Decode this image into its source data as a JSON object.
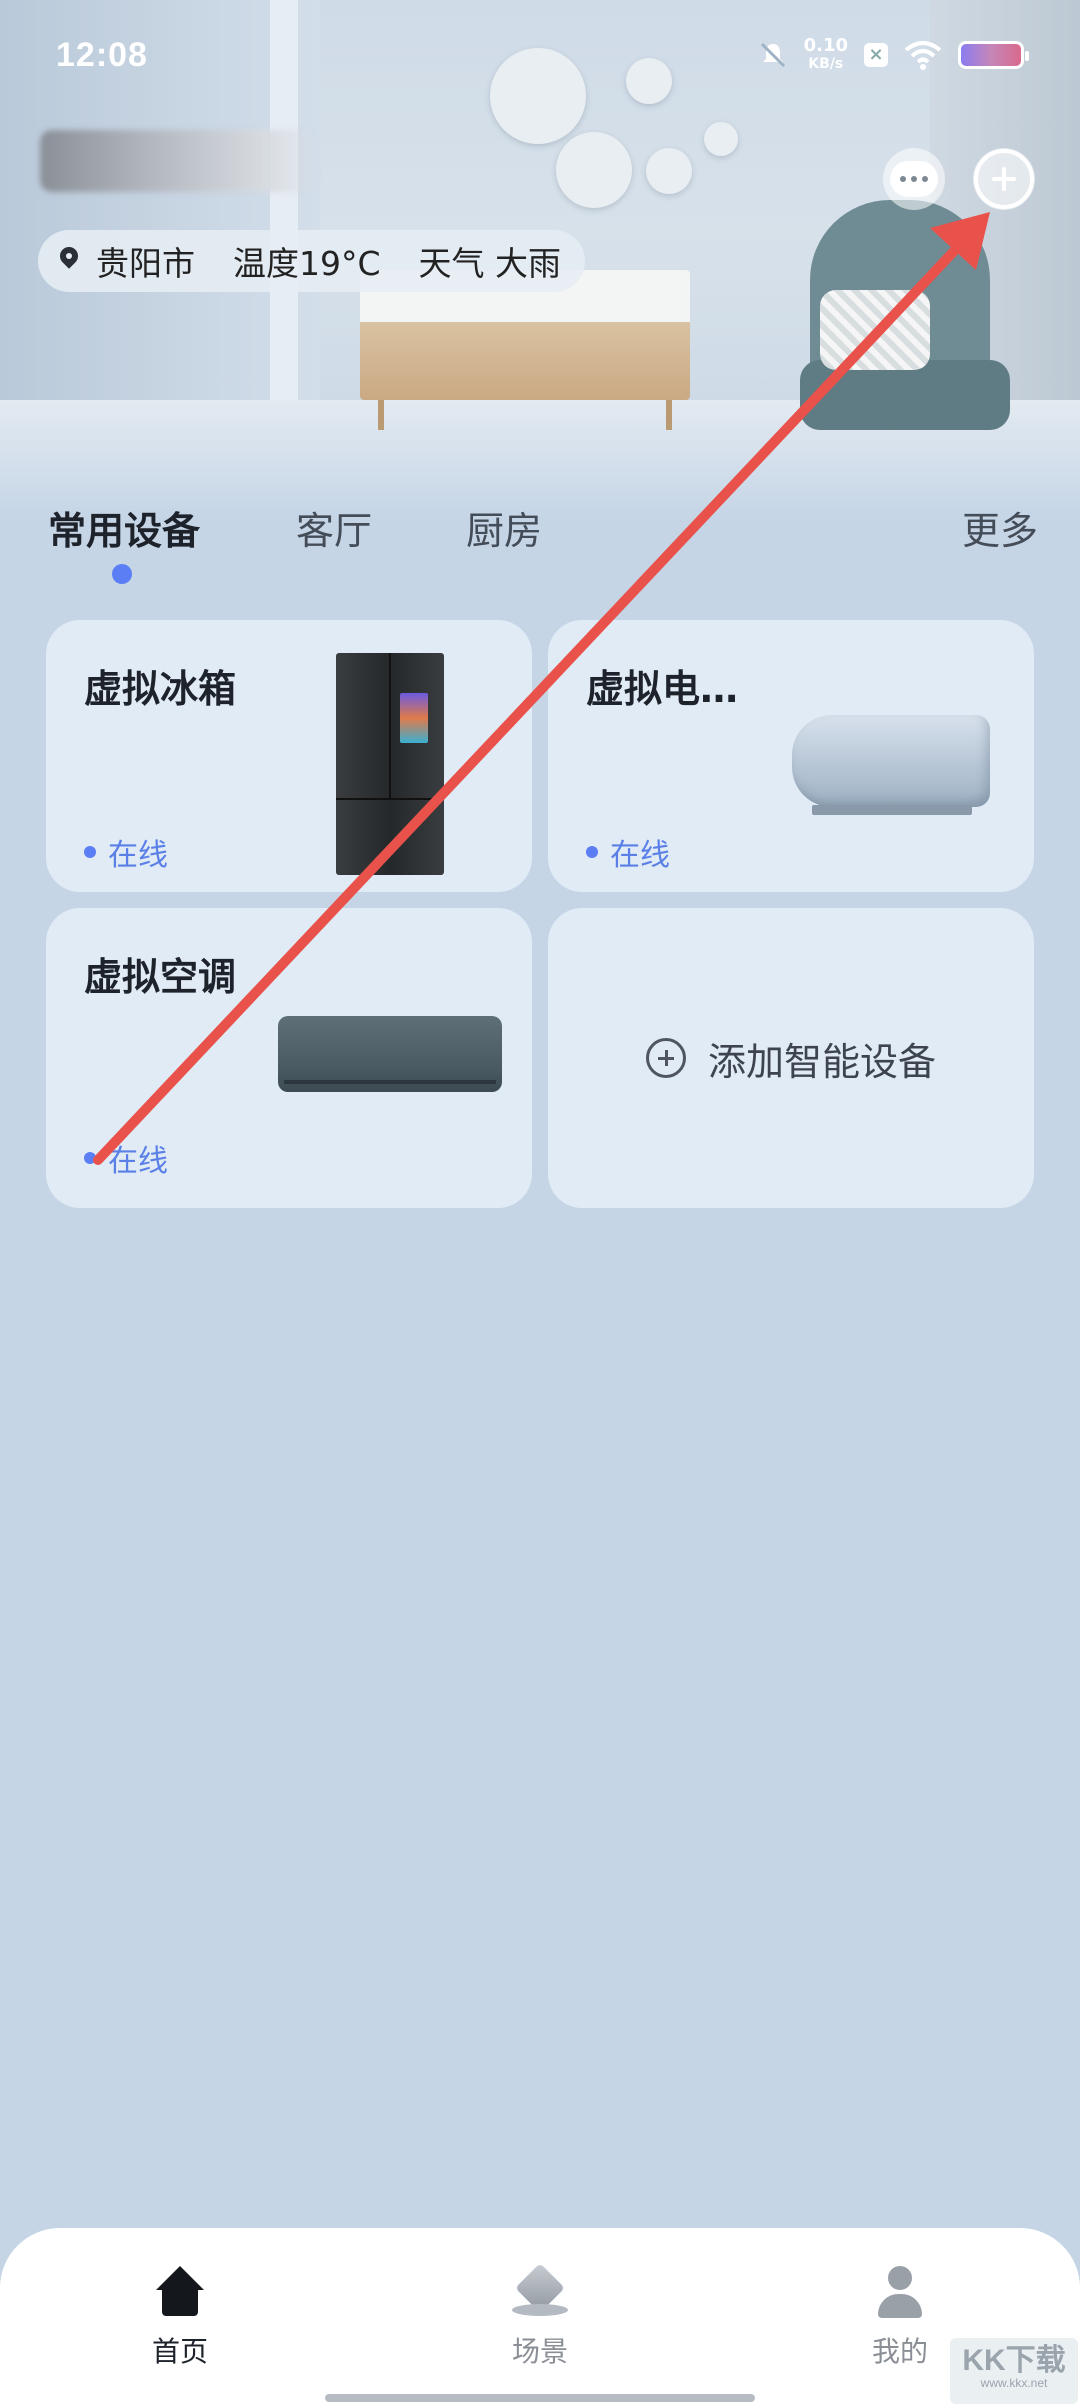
{
  "status_bar": {
    "time": "12:08",
    "net_speed_value": "0.10",
    "net_speed_unit": "KB/s"
  },
  "location": {
    "city": "贵阳市",
    "temperature": "温度19°C",
    "weather": "天气 大雨"
  },
  "tabs": [
    {
      "label": "常用设备",
      "active": true
    },
    {
      "label": "客厅"
    },
    {
      "label": "厨房"
    }
  ],
  "more_label": "更多",
  "devices": [
    {
      "name": "虚拟冰箱",
      "status": "在线"
    },
    {
      "name": "虚拟电…",
      "status": "在线"
    },
    {
      "name": "虚拟空调",
      "status": "在线"
    }
  ],
  "add_device_label": "添加智能设备",
  "bottom_nav": [
    {
      "label": "首页",
      "active": true
    },
    {
      "label": "场景"
    },
    {
      "label": "我的"
    }
  ],
  "watermark": {
    "text": "KK下载",
    "url": "www.kkx.net"
  },
  "colors": {
    "accent": "#5b7ef5",
    "background": "#c5d5e6",
    "card": "#e1ebf5",
    "annotation_arrow": "#e8524a"
  },
  "icons": {
    "location": "location-pin-icon",
    "message": "message-icon",
    "add": "add-circle-icon",
    "home": "home-icon",
    "scene": "scene-icon",
    "mine": "profile-icon"
  }
}
